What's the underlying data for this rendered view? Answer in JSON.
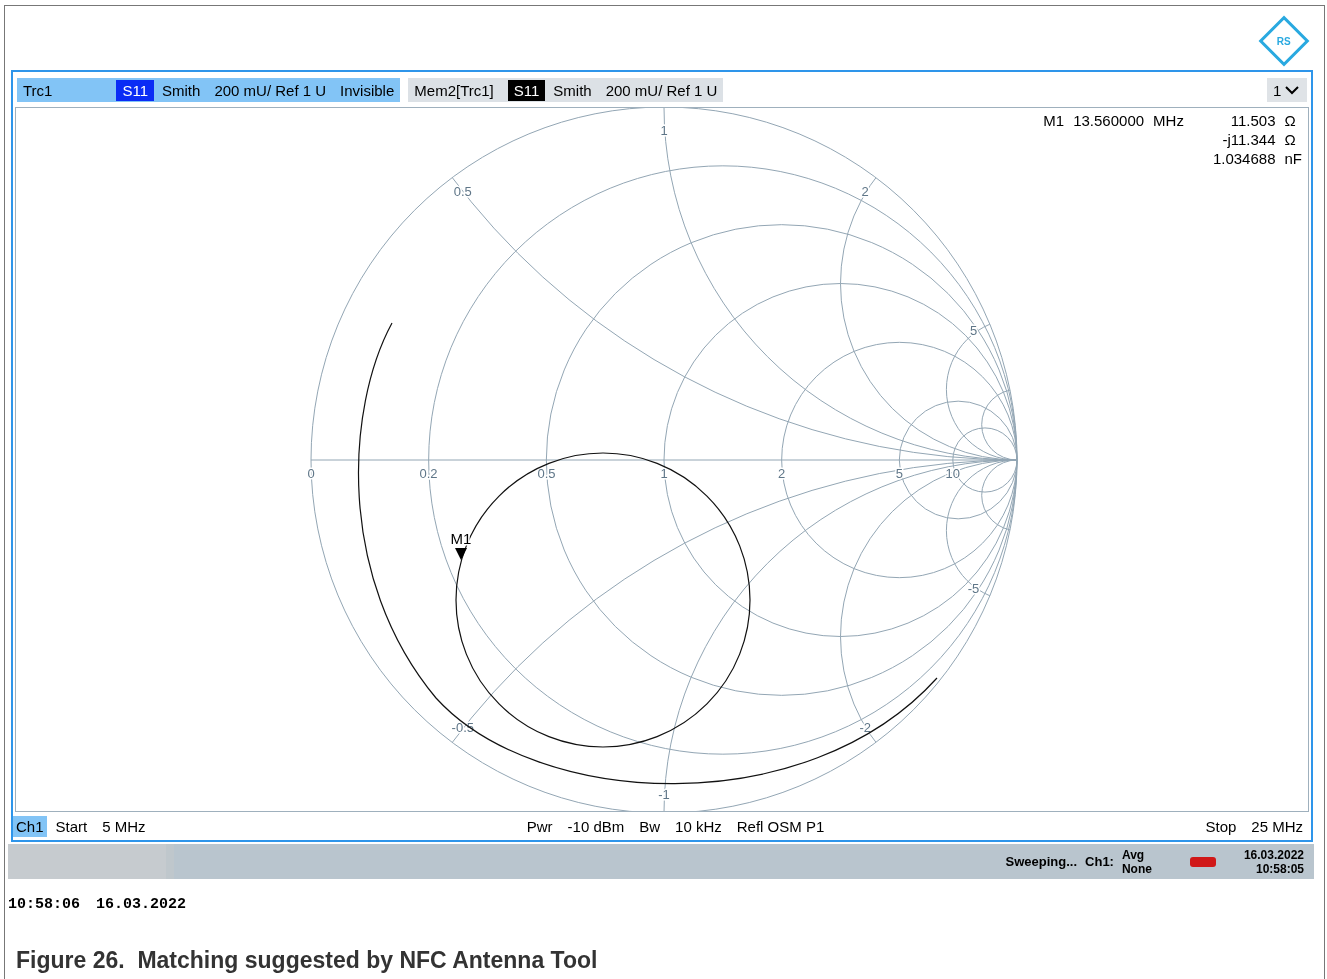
{
  "logo": {
    "text": "RS"
  },
  "traces": [
    {
      "kind": "active",
      "label": "Trc1",
      "param": "S11",
      "format": "Smith",
      "scale": "200 mU/ Ref 1 U",
      "extra": "Invisible"
    },
    {
      "kind": "memory",
      "label": "Mem2[Trc1]",
      "param": "S11",
      "format": "Smith",
      "scale": "200 mU/ Ref 1 U"
    }
  ],
  "window_selector": "1",
  "marker_readout": {
    "marker": "M1",
    "frequency": "13.560000",
    "frequency_unit": "MHz",
    "values": [
      {
        "value": "11.503",
        "unit": "Ω"
      },
      {
        "value": "-j11.344",
        "unit": "Ω"
      },
      {
        "value": "1.034688",
        "unit": "nF"
      }
    ]
  },
  "chart": {
    "real_axis_labels": [
      "0",
      "0.2",
      "0.5",
      "1",
      "2",
      "5",
      "10"
    ],
    "upper_labels": [
      "0.5",
      "1",
      "2",
      "5"
    ],
    "lower_labels": [
      "-0.5",
      "-1",
      "-2",
      "-5"
    ],
    "marker": "M1"
  },
  "channel_bar": {
    "channel": "Ch1",
    "start_label": "Start",
    "start": "5 MHz",
    "pwr_label": "Pwr",
    "pwr": "-10 dBm",
    "bw_label": "Bw",
    "bw": "10 kHz",
    "cal": "Refl OSM P1",
    "stop_label": "Stop",
    "stop": "25 MHz"
  },
  "status_bar": {
    "state": "Sweeping...",
    "channel": "Ch1:",
    "avg": "Avg",
    "avg_value": "None",
    "date": "16.03.2022",
    "time": "10:58:05"
  },
  "timestamp": {
    "time": "10:58:06",
    "date": "16.03.2022"
  },
  "caption": "Figure 26.  Matching suggested by NFC Antenna Tool"
}
